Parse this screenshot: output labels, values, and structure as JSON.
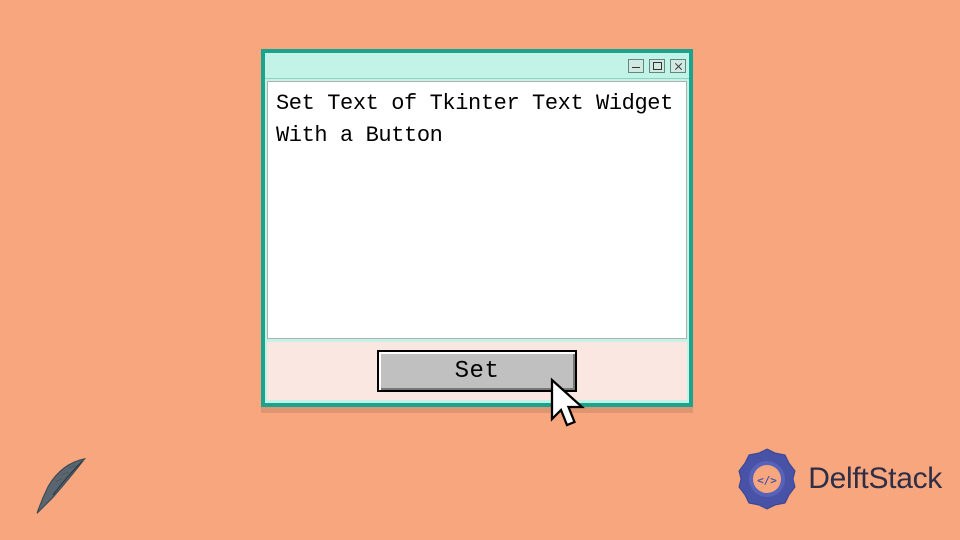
{
  "window": {
    "text_content": "Set Text of Tkinter Text Widget With a Button",
    "button_label": "Set"
  },
  "branding": {
    "logo_text": "DelftStack"
  }
}
